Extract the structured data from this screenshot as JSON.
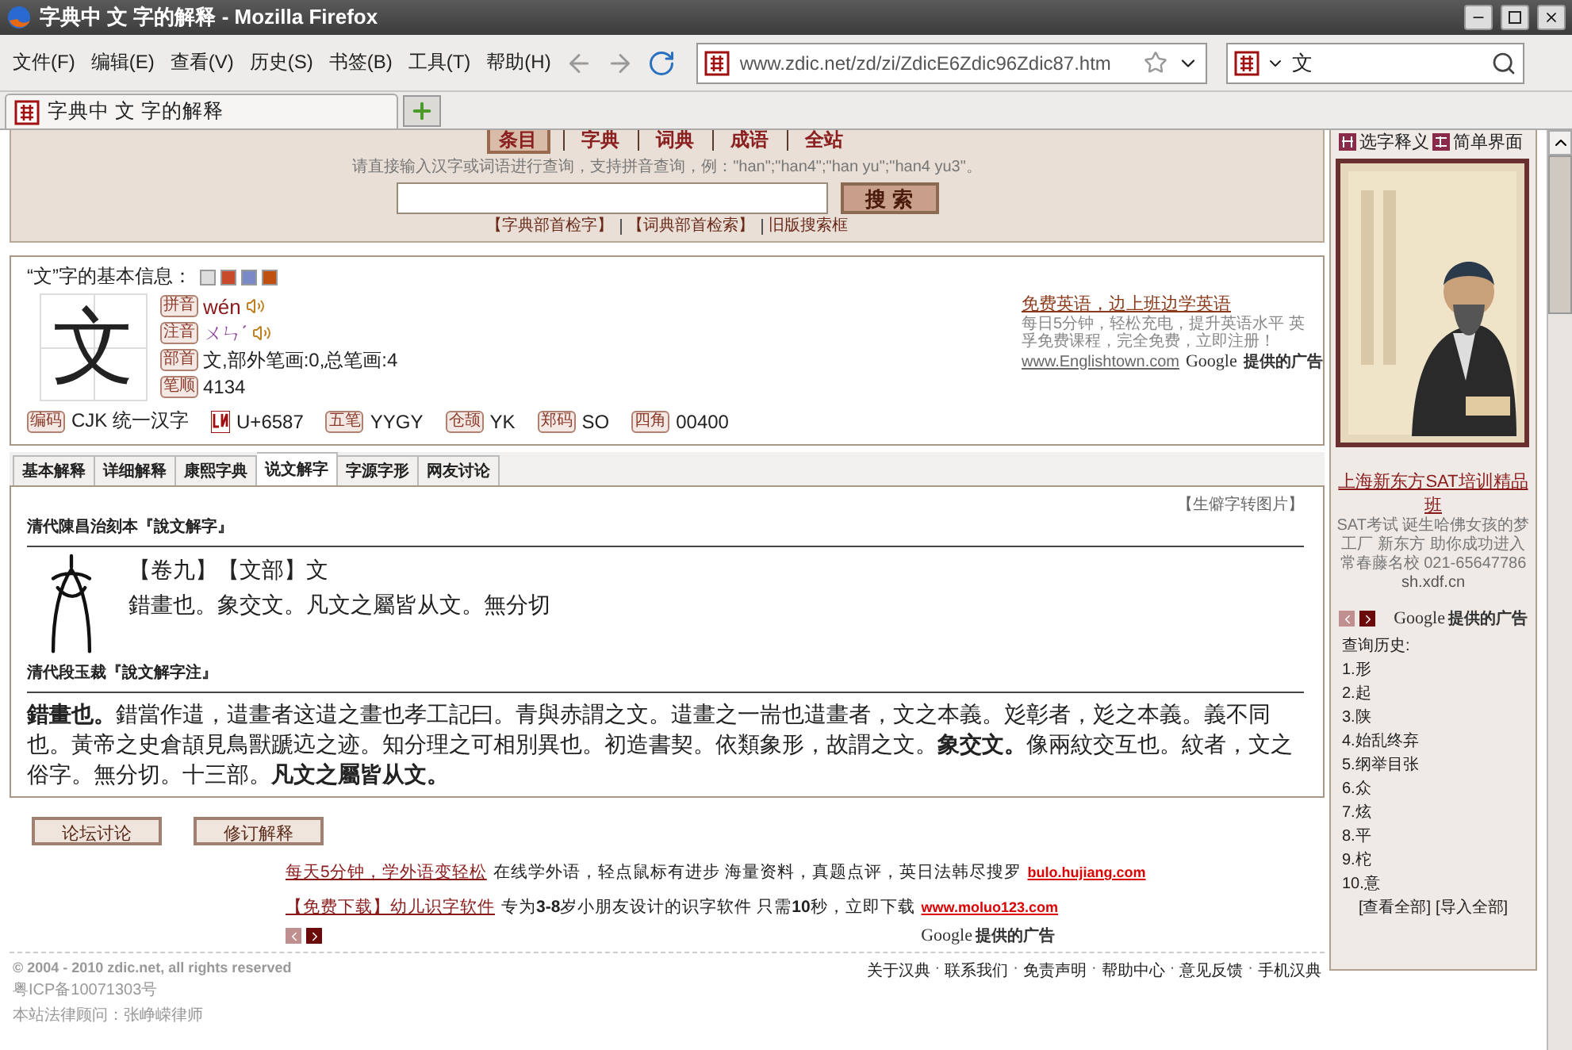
{
  "window": {
    "title": "字典中 文 字的解释 - Mozilla Firefox"
  },
  "menu": [
    "文件(F)",
    "编辑(E)",
    "查看(V)",
    "历史(S)",
    "书签(B)",
    "工具(T)",
    "帮助(H)"
  ],
  "address": {
    "value": "www.zdic.net/zd/zi/ZdicE6Zdic96Zdic87.htm"
  },
  "browser_search": {
    "value": "文"
  },
  "tabs": [
    {
      "label": "字典中 文 字的解释",
      "selected": true
    }
  ],
  "page": {
    "nav_tabs": [
      {
        "label": "条目",
        "selected": true
      },
      {
        "label": "字典",
        "selected": false
      },
      {
        "label": "词典",
        "selected": false
      },
      {
        "label": "成语",
        "selected": false
      },
      {
        "label": "全站",
        "selected": false
      }
    ],
    "search_hint": "请直接输入汉字或词语进行查询，支持拼音查询，例：\"han\";\"han4\";\"han yu\";\"han4 yu3\"。",
    "search_button": "搜 索",
    "search_links": [
      "【字典部首检字】",
      "【词典部首检索】",
      "旧版搜索框"
    ],
    "info": {
      "heading": "“文”字的基本信息：",
      "glyph": "文",
      "details": [
        {
          "tag": "拼音",
          "value": "wén",
          "kind": "sound"
        },
        {
          "tag": "注音",
          "value": "ㄨㄣˊ",
          "kind": "sound"
        },
        {
          "tag": "部首",
          "value": "文,部外笔画:0,总笔画:4",
          "kind": "plain"
        },
        {
          "tag": "笔顺",
          "value": "4134",
          "kind": "plain"
        }
      ],
      "codes": [
        {
          "kind": "tag",
          "tag": "编码",
          "value": "CJK 统一汉字"
        },
        {
          "kind": "unicode",
          "value": "U+6587"
        },
        {
          "kind": "tag",
          "tag": "五笔",
          "value": "YYGY"
        },
        {
          "kind": "tag",
          "tag": "仓颉",
          "value": "YK"
        },
        {
          "kind": "tag",
          "tag": "郑码",
          "value": "SO"
        },
        {
          "kind": "tag",
          "tag": "四角",
          "value": "00400"
        }
      ],
      "ad": {
        "title": "免费英语，边上班边学英语",
        "text": "每日5分钟，轻松充电，提升英语水平 英孚免费课程，完全免费，立即注册！",
        "url": "www.Englishtown.com",
        "brand": "Google",
        "note": "提供的广告"
      }
    },
    "char_tabs": [
      {
        "label": "基本解释",
        "selected": false
      },
      {
        "label": "详细解释",
        "selected": false
      },
      {
        "label": "康熙字典",
        "selected": false
      },
      {
        "label": "说文解字",
        "selected": true
      },
      {
        "label": "字源字形",
        "selected": false
      },
      {
        "label": "网友讨论",
        "selected": false
      }
    ],
    "shuowen": {
      "image_link": "【生僻字转图片】",
      "edition_1": "清代陳昌治刻本『說文解字』",
      "line_1": "【卷九】【文部】文",
      "line_2": "錯畫也。象交文。凡文之屬皆从文。無分切",
      "edition_2": "清代段玉裁『說文解字注』",
      "commentary": "**錯畫也。**錯當作逪，逪畫者这逪之畫也孝工記曰。青與赤謂之文。逪畫之一耑也逪畫者，文之本義。彣彰者，彣之本義。義不同也。黃帝之史倉頡見鳥獸蹏迒之迹。知分理之可相別異也。初造書契。依類象形，故謂之文。**象交文。**像兩紋交互也。紋者，文之俗字。無分切。十三部。**凡文之屬皆从文。**"
    },
    "buttons": [
      "论坛讨论",
      "修订解释"
    ],
    "ads": [
      {
        "title": "每天5分钟，学外语变轻松",
        "text": "在线学外语，轻点鼠标有进步 海量资料，真题点评，英日法韩尽搜罗",
        "url": "bulo.hujiang.com"
      },
      {
        "title": "【免费下载】幼儿识字软件",
        "text": "专为**3-8**岁小朋友设计的识字软件 只需**10**秒，立即下载",
        "url": "www.moluo123.com"
      }
    ],
    "ads_brand": "Google",
    "ads_note": "提供的广告",
    "footer": {
      "lines": [
        "© 2004 - 2010 zdic.net, all rights reserved",
        "粤ICP备10071303号",
        "本站法律顾问：张峥嵘律师"
      ],
      "separator": "·",
      "links": [
        "关于汉典",
        "联系我们",
        "免责声明",
        "帮助中心",
        "意见反馈",
        "手机汉典"
      ]
    },
    "sidebar": {
      "links": [
        "选字释义",
        "简单界面"
      ],
      "ad": {
        "title": "上海新东方SAT培训精品班",
        "text": "SAT考试 诞生哈佛女孩的梦工厂 新东方 助你成功进入常春藤名校 021-65647786",
        "url": "sh.xdf.cn",
        "brand": "Google",
        "note": "提供的广告"
      },
      "history_title": "查询历史:",
      "history": [
        "1.形",
        "2.起",
        "3.陕",
        "4.始乱终弃",
        "5.纲举目张",
        "6.众",
        "7.炫",
        "8.平",
        "9.柁",
        "10.意"
      ],
      "history_links": [
        "[查看全部]",
        "[导入全部]"
      ]
    }
  }
}
